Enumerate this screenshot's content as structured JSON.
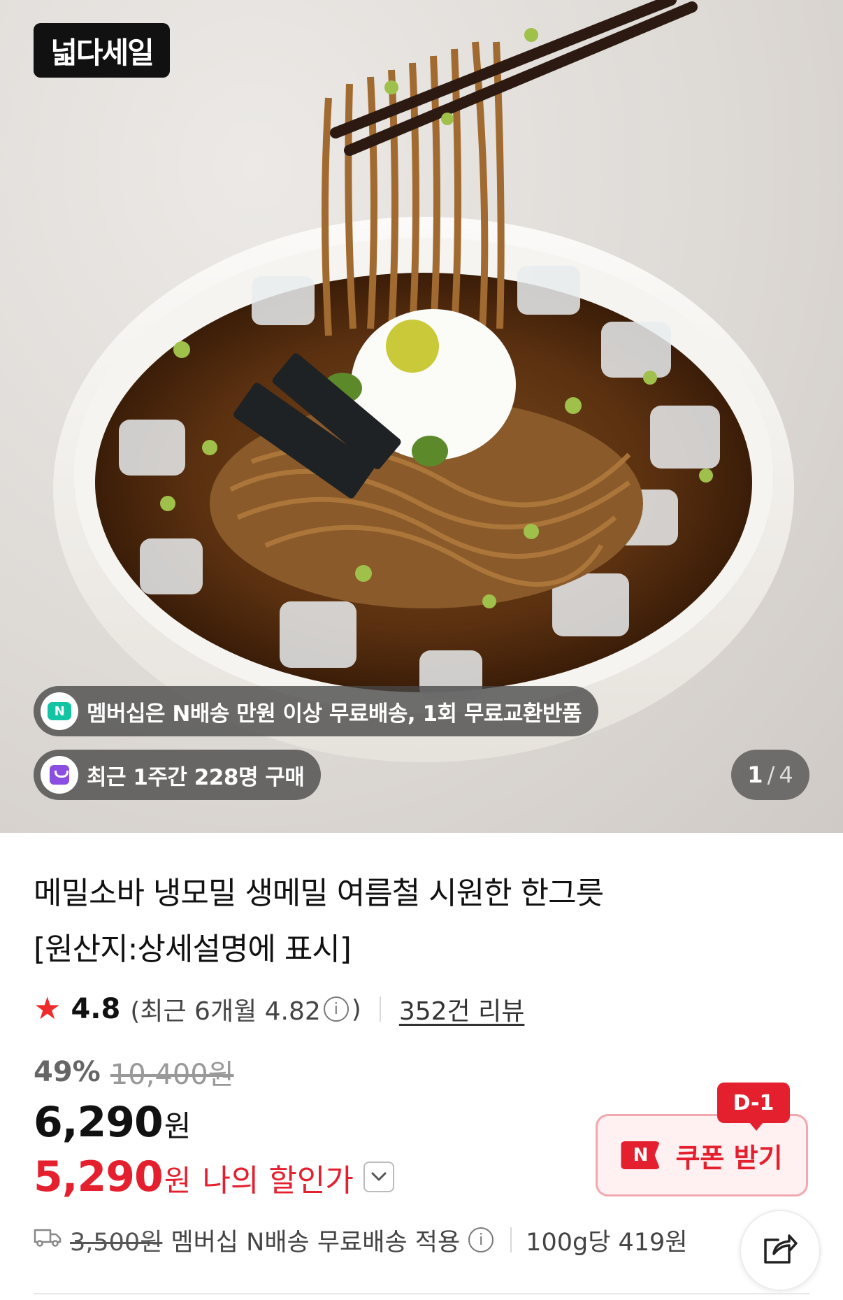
{
  "hero": {
    "logo_text": "넓다세일",
    "membership_text": "멤버십은 N배송 만원 이상 무료배송, 1회 무료교환반품",
    "purchase_text": "최근 1주간 228명 구매",
    "counter_current": "1",
    "counter_separator": "/",
    "counter_total": "4"
  },
  "product": {
    "title_line1": "메밀소바 냉모밀 생메밀 여름철 시원한 한그릇",
    "title_line2": "[원산지:상세설명에 표시]"
  },
  "rating": {
    "score": "4.8",
    "recent_open": "(최근 6개월 4.82",
    "recent_close": ")",
    "info_glyph": "i",
    "review_link": "352건 리뷰"
  },
  "pricing": {
    "discount_rate": "49%",
    "original_price": "10,400원",
    "price_value": "6,290",
    "price_unit": "원",
    "my_price_value": "5,290",
    "my_price_unit": "원",
    "my_price_label": "나의 할인가"
  },
  "coupon": {
    "dday": "D-1",
    "badge": "N",
    "label": "쿠폰 받기"
  },
  "shipping": {
    "original_fee": "3,500원",
    "label": "멤버십 N배송 무료배송 적용",
    "info_glyph": "i",
    "per_gram": "100g당 419원"
  },
  "colors": {
    "accent_red": "#e4202f",
    "star_red": "#ef2b2b",
    "coupon_bg": "#fff1f2",
    "n_green": "#12c4a4",
    "bag_purple": "#8a4fe0"
  },
  "icons": {
    "star": "star-icon",
    "info": "info-circle-icon",
    "chevron": "chevron-down-icon",
    "truck": "truck-icon",
    "share": "share-icon",
    "membership": "n-delivery-icon",
    "purchase": "shopping-bag-icon"
  }
}
